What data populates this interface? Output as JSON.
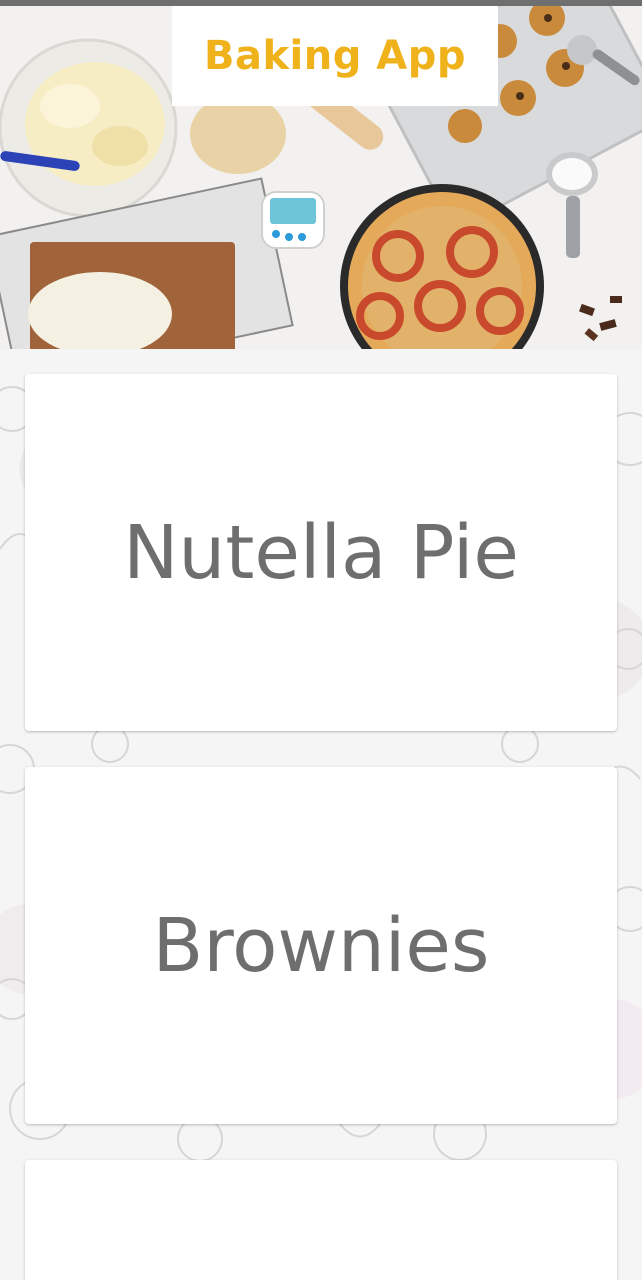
{
  "app": {
    "title": "Baking App"
  },
  "colors": {
    "title_accent": "#f0b21a",
    "card_text": "#6e6e6e",
    "card_background": "#ffffff"
  },
  "recipes": [
    {
      "name": "Nutella Pie"
    },
    {
      "name": "Brownies"
    },
    {
      "name": ""
    }
  ]
}
